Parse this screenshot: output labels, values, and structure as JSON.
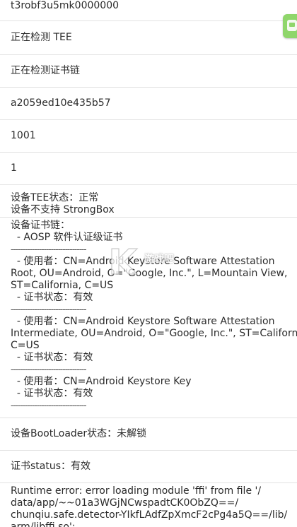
{
  "rows": [
    "t3robf3u5mk0000000",
    "正在检测 TEE",
    "正在检测证书链",
    "a2059ed10e435b57",
    "1001",
    "1"
  ],
  "tee_block": {
    "status": "设备TEE状态：正常",
    "strongbox": "设备不支持 StrongBox"
  },
  "cert_chain": {
    "title": "设备证书链：",
    "type": "  - AOSP 软件认证级证书",
    "divider": "--------------------------------",
    "certs": [
      {
        "subject_lines": [
          "  - 使用者：CN=Android Keystore Software Attestation",
          "Root, OU=Android, O=\"Google, Inc.\", L=Mountain View,",
          "ST=California, C=US"
        ],
        "status": "  - 证书状态：有效"
      },
      {
        "subject_lines": [
          "  - 使用者：CN=Android Keystore Software Attestation",
          "Intermediate, OU=Android, O=\"Google, Inc.\", ST=California,",
          "C=US"
        ],
        "status": "  - 证书状态：有效"
      },
      {
        "subject_lines": [
          "  - 使用者：CN=Android Keystore Key"
        ],
        "status": "  - 证书状态：有效"
      }
    ]
  },
  "bootloader": "设备BootLoader状态：未解锁",
  "cert_status": "证书status：有效",
  "error_lines": [
    "Runtime error: error loading module 'ffi' from file '/",
    "data/app/~~01a3WGjNCwspadtCK0ObZQ==/",
    "chunqiu.safe.detector-YIkfLAdfZpXmcF2cPg4a5Q==/lib/",
    "arm/libffi.so':"
  ],
  "watermark_text": "游戏吧"
}
